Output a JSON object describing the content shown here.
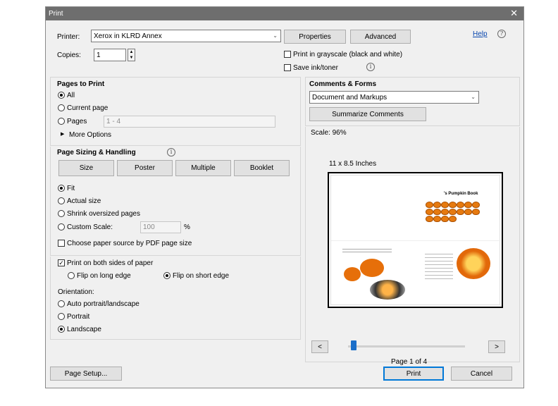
{
  "window": {
    "title": "Print",
    "close_glyph": "✕"
  },
  "printer": {
    "label": "Printer:",
    "selected": "Xerox in KLRD Annex",
    "properties_label": "Properties",
    "advanced_label": "Advanced",
    "help_label": "Help",
    "copies_label": "Copies:",
    "copies_value": "1",
    "grayscale_label": "Print in grayscale (black and white)",
    "grayscale_checked": false,
    "save_ink_label": "Save ink/toner",
    "save_ink_checked": false
  },
  "pages_to_print": {
    "heading": "Pages to Print",
    "all_label": "All",
    "current_page_label": "Current page",
    "pages_label": "Pages",
    "pages_value": "1 - 4",
    "more_options_label": "More Options",
    "selected": "All"
  },
  "sizing": {
    "heading": "Page Sizing & Handling",
    "tabs": [
      "Size",
      "Poster",
      "Multiple",
      "Booklet"
    ],
    "fit_label": "Fit",
    "actual_size_label": "Actual size",
    "shrink_label": "Shrink oversized pages",
    "custom_scale_label": "Custom Scale:",
    "custom_scale_value": "100",
    "percent_label": "%",
    "paper_source_label": "Choose paper source by PDF page size",
    "selected": "Fit",
    "duplex_label": "Print on both sides of paper",
    "duplex_checked": true,
    "flip_long_label": "Flip on long edge",
    "flip_short_label": "Flip on short edge",
    "flip_selected": "short",
    "orientation_label": "Orientation:",
    "auto_label": "Auto portrait/landscape",
    "portrait_label": "Portrait",
    "landscape_label": "Landscape",
    "orientation_selected": "Landscape"
  },
  "comments": {
    "heading": "Comments & Forms",
    "selected": "Document and Markups",
    "summarize_label": "Summarize Comments"
  },
  "preview": {
    "scale_text": "Scale:  96%",
    "paper_size": "11 x 8.5 Inches",
    "page_title": "'s Pumpkin Book",
    "page_indicator": "Page 1 of 4",
    "prev_glyph": "<",
    "next_glyph": ">",
    "slider_fraction": 0.05
  },
  "footer": {
    "page_setup_label": "Page Setup...",
    "print_label": "Print",
    "cancel_label": "Cancel"
  }
}
